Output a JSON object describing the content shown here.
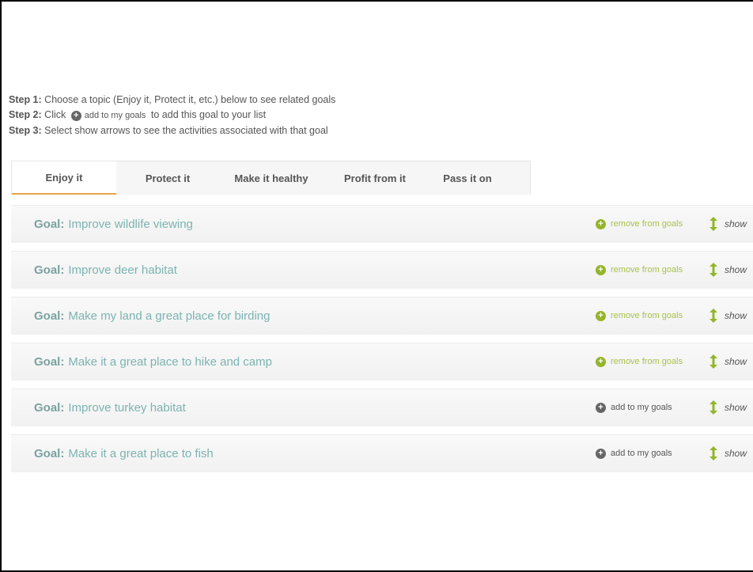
{
  "instructions": {
    "step1_label": "Step 1:",
    "step1_text": "Choose a topic (Enjoy it, Protect it, etc.) below to see related goals",
    "step2_label": "Step 2:",
    "step2_text_before": "Click",
    "step2_button": "add to my goals",
    "step2_text_after": "to add this goal to your list",
    "step3_label": "Step 3:",
    "step3_text": "Select show arrows to see the activities associated with that goal"
  },
  "tabs": [
    {
      "label": "Enjoy it",
      "active": true
    },
    {
      "label": "Protect it",
      "active": false
    },
    {
      "label": "Make it healthy",
      "active": false
    },
    {
      "label": "Profit from it",
      "active": false
    },
    {
      "label": "Pass it on",
      "active": false
    }
  ],
  "goal_prefix": "Goal:",
  "goals": [
    {
      "title": "Improve wildlife viewing",
      "action": "remove from goals",
      "state": "remove",
      "show": "show"
    },
    {
      "title": "Improve deer habitat",
      "action": "remove from goals",
      "state": "remove",
      "show": "show"
    },
    {
      "title": "Make my land a great place for birding",
      "action": "remove from goals",
      "state": "remove",
      "show": "show"
    },
    {
      "title": "Make it a great place to hike and camp",
      "action": "remove from goals",
      "state": "remove",
      "show": "show"
    },
    {
      "title": "Improve turkey habitat",
      "action": "add to my goals",
      "state": "add",
      "show": "show"
    },
    {
      "title": "Make it a great place to fish",
      "action": "add to my goals",
      "state": "add",
      "show": "show"
    }
  ],
  "colors": {
    "accent_green": "#94b52a",
    "goal_teal": "#7bb4b1",
    "tab_underline": "#e8a34a"
  },
  "icons": {
    "add": "plus-circle-icon",
    "show": "up-down-arrow-icon"
  }
}
